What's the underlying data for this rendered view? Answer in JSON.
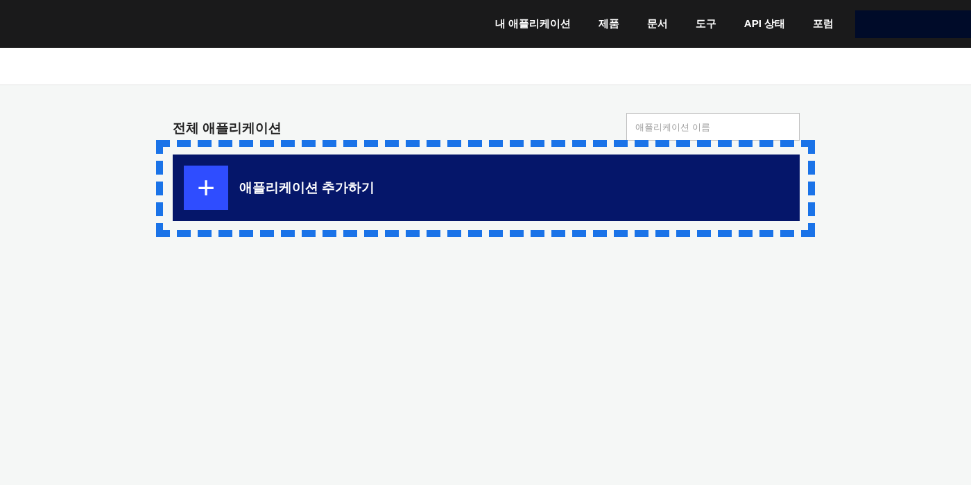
{
  "nav": {
    "items": [
      "내 애플리케이션",
      "제품",
      "문서",
      "도구",
      "API 상태",
      "포럼"
    ]
  },
  "content": {
    "title": "전체 애플리케이션",
    "search": {
      "placeholder": "애플리케이션 이름"
    },
    "add_card": {
      "label": "애플리케이션 추가하기",
      "icon": "+"
    }
  }
}
